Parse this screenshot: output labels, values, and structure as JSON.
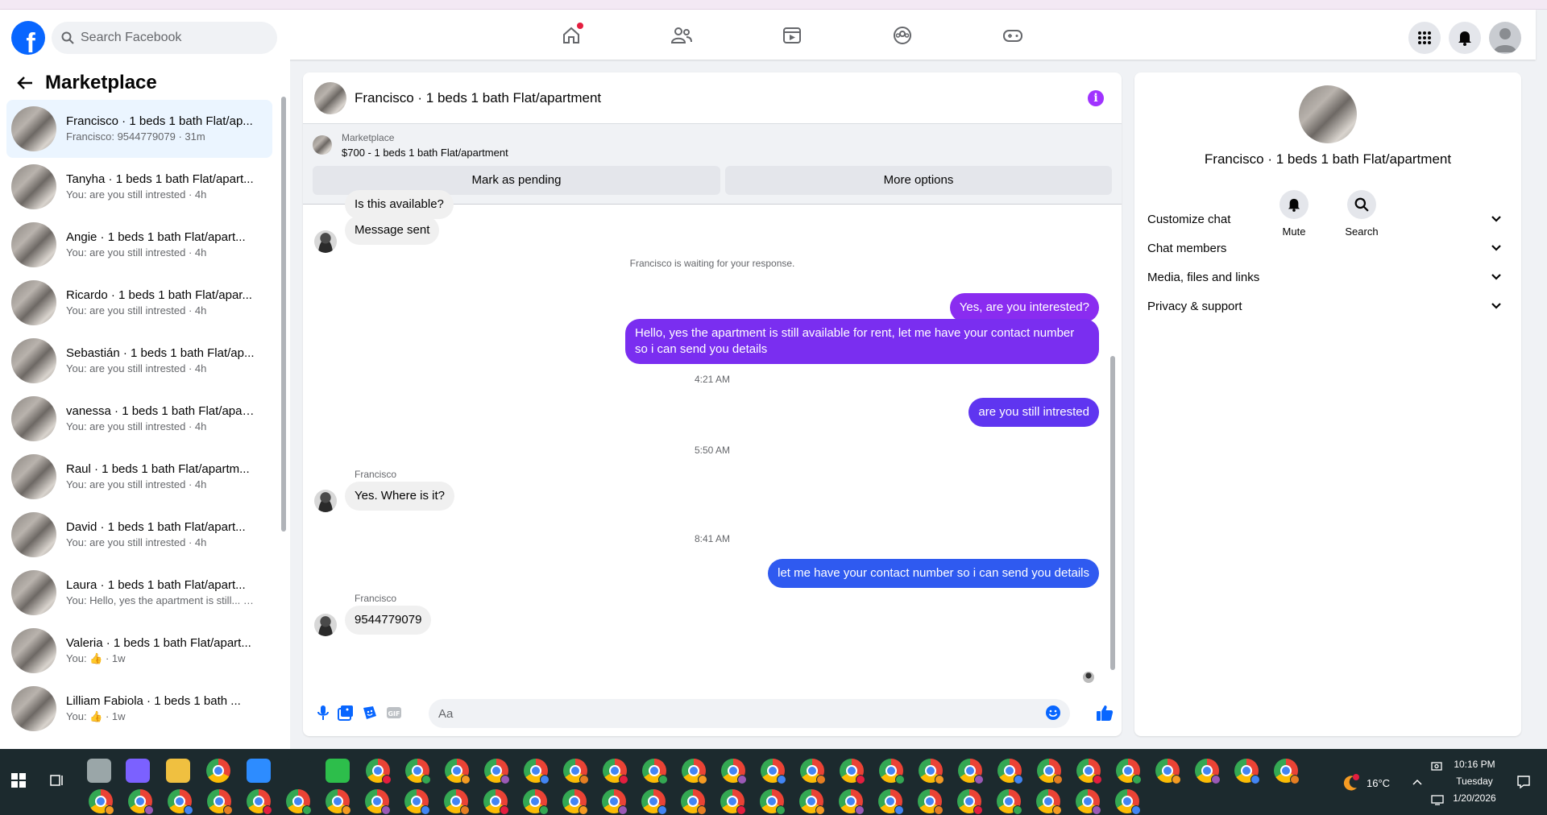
{
  "topnav": {
    "logo": "f",
    "search_placeholder": "Search Facebook"
  },
  "sidebar": {
    "title": "Marketplace",
    "conversations": [
      {
        "name": "Francisco · 1 beds 1 bath Flat/ap...",
        "sub": "Francisco: 9544779079 · 31m",
        "active": true
      },
      {
        "name": "Tanyha · 1 beds 1 bath Flat/apart...",
        "sub": "You: are you still intrested · 4h"
      },
      {
        "name": "Angie · 1 beds 1 bath Flat/apart...",
        "sub": "You: are you still intrested · 4h"
      },
      {
        "name": "Ricardo · 1 beds 1 bath Flat/apar...",
        "sub": "You: are you still intrested · 4h"
      },
      {
        "name": "Sebastián · 1 beds 1 bath Flat/ap...",
        "sub": "You: are you still intrested · 4h"
      },
      {
        "name": "vanessa · 1 beds 1 bath Flat/apar...",
        "sub": "You: are you still intrested · 4h"
      },
      {
        "name": "Raul · 1 beds 1 bath Flat/apartm...",
        "sub": "You: are you still intrested · 4h"
      },
      {
        "name": "David · 1 beds 1 bath Flat/apart...",
        "sub": "You: are you still intrested · 4h"
      },
      {
        "name": "Laura · 1 beds 1 bath Flat/apart...",
        "sub": "You: Hello, yes the apartment is still... · 4h"
      },
      {
        "name": "Valeria · 1 beds 1 bath Flat/apart...",
        "sub": "You: 👍 · 1w"
      },
      {
        "name": "Lilliam Fabiola · 1 beds 1 bath ...",
        "sub": "You: 👍 · 1w"
      }
    ]
  },
  "chat": {
    "title": "Francisco · 1 beds 1 bath Flat/apartment",
    "listing_label": "Marketplace",
    "listing_title": "$700 - 1 beds 1 bath Flat/apartment",
    "btn_pending": "Mark as pending",
    "btn_more": "More options",
    "cut_msg": "Is this available?",
    "msg_sent": "Message sent",
    "waiting": "Francisco is waiting for your response.",
    "out1": "Yes, are you interested?",
    "out2": "Hello, yes the apartment is still available for rent, let me have your contact number so i can send you details",
    "time1": "4:21 AM",
    "out3": "are you still intrested",
    "time2": "5:50 AM",
    "sender1": "Francisco",
    "in1": "Yes. Where is it?",
    "time3": "8:41 AM",
    "out4": "let me have your contact number so i can send you details",
    "sender2": "Francisco",
    "in2": "9544779079",
    "composer_placeholder": "Aa",
    "colors": {
      "purple": "#8a2cf0",
      "violet": "#6a2ff0",
      "blue": "#2f5af0"
    }
  },
  "rpanel": {
    "name": "Francisco · 1 beds 1 bath Flat/apartment",
    "mute": "Mute",
    "search": "Search",
    "rows": [
      "Customize chat",
      "Chat members",
      "Media, files and links",
      "Privacy & support"
    ]
  },
  "taskbar": {
    "temp": "16°C",
    "time": "10:16 PM",
    "day": "Tuesday",
    "date": "1/20/2026"
  }
}
